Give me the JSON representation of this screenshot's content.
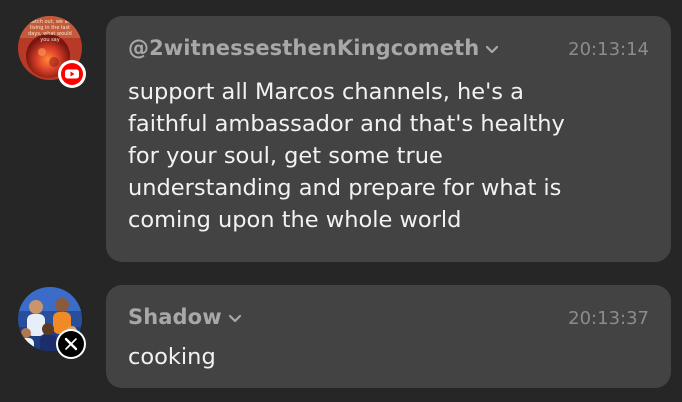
{
  "messages": [
    {
      "author": "@2witnessesthenKingcometh",
      "time": "20:13:14",
      "platform": "youtube",
      "platform_icon": "youtube-icon",
      "avatar_text": "Watch out, we are living in the last days, what would you say",
      "text": "support all Marcos channels, he's a\nfaithful ambassador and that's healthy\nfor your soul, get some true\nunderstanding and prepare for what is\ncoming upon the whole world"
    },
    {
      "author": "Shadow",
      "time": "20:13:37",
      "platform": "x",
      "platform_icon": "x-icon",
      "text": "cooking"
    }
  ],
  "colors": {
    "background": "#262626",
    "bubble": "#434343",
    "author": "#a8a8a8",
    "time": "#8c8c8c",
    "text": "#f2f2f2",
    "youtube_red": "#ff0000"
  }
}
